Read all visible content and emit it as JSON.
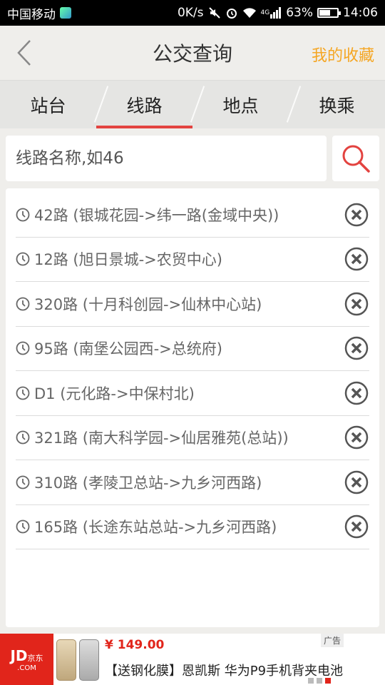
{
  "status": {
    "carrier": "中国移动",
    "net_speed": "0K/s",
    "battery": "63%",
    "battery_fraction": 0.63,
    "time": "14:06",
    "signal_label": "4G"
  },
  "header": {
    "title": "公交查询",
    "favorites": "我的收藏"
  },
  "tabs": [
    {
      "label": "站台",
      "active": false
    },
    {
      "label": "线路",
      "active": true
    },
    {
      "label": "地点",
      "active": false
    },
    {
      "label": "换乘",
      "active": false
    }
  ],
  "search": {
    "placeholder": "线路名称,如46"
  },
  "history": [
    "42路 (银城花园->纬一路(金域中央))",
    "12路 (旭日景城->农贸中心)",
    "320路 (十月科创园->仙林中心站)",
    "95路 (南堡公园西->总统府)",
    "D1 (元化路->中保村北)",
    "321路 (南大科学园->仙居雅苑(总站))",
    "310路 (孝陵卫总站->九乡河西路)",
    "165路 (长途东站总站->九乡河西路)"
  ],
  "ad": {
    "brand_main": "JD",
    "brand_sub": "京东",
    "brand_com": ".COM",
    "price": "¥ 149.00",
    "description": "【送钢化膜】恩凯斯 华为P9手机背夹电池",
    "badge": "广告"
  },
  "colors": {
    "accent": "#e34340",
    "favorites": "#f5a623",
    "jd_red": "#e1251b"
  }
}
